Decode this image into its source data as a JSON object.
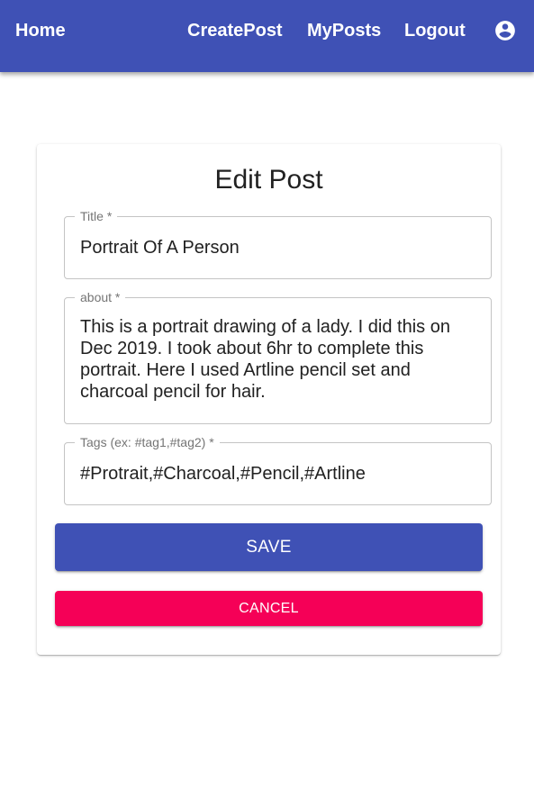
{
  "appbar": {
    "home_label": "Home",
    "create_post_label": "CreatePost",
    "my_posts_label": "MyPosts",
    "logout_label": "Logout",
    "account_icon": "account-circle-icon",
    "color": "#3f51b5"
  },
  "form": {
    "heading": "Edit Post",
    "title_field": {
      "label": "Title *",
      "value": "Portrait Of A Person"
    },
    "about_field": {
      "label": "about *",
      "value": "This is a portrait drawing of a lady. I did this on Dec 2019. I took about 6hr to complete this portrait. Here I used Artline pencil set and charcoal pencil for hair."
    },
    "tags_field": {
      "label": "Tags (ex: #tag1,#tag2) *",
      "value": "#Protrait,#Charcoal,#Pencil,#Artline"
    },
    "save_label": "SAVE",
    "cancel_label": "CANCEL",
    "save_color": "#3f51b5",
    "cancel_color": "#f50057"
  }
}
